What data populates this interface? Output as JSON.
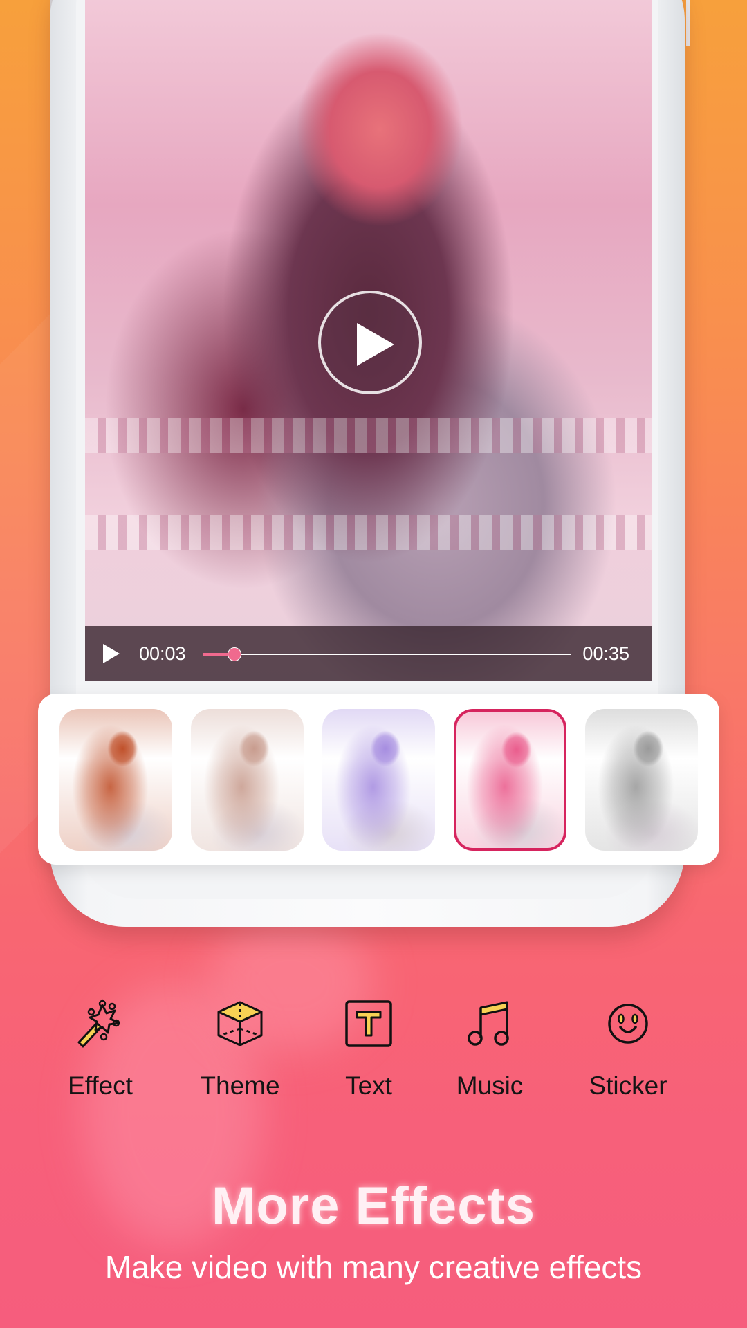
{
  "player": {
    "current_time": "00:03",
    "total_time": "00:35",
    "progress_fraction": 0.0857,
    "big_play_icon": "play-icon",
    "control_play_icon": "play-icon"
  },
  "filters": {
    "selected_index": 3,
    "items": [
      {
        "name": "vivid-warm",
        "tint": "#c0502a"
      },
      {
        "name": "sepia-sketch",
        "tint": "#c89c8e"
      },
      {
        "name": "violet",
        "tint": "#a68de0"
      },
      {
        "name": "pink-sketch",
        "tint": "#ea5d8d"
      },
      {
        "name": "mono-sketch",
        "tint": "#9a9a9a"
      }
    ],
    "selected_border_color": "#d6245e"
  },
  "tools": [
    {
      "label": "Effect",
      "icon": "magic-wand-icon"
    },
    {
      "label": "Theme",
      "icon": "cube-icon"
    },
    {
      "label": "Text",
      "icon": "text-box-icon"
    },
    {
      "label": "Music",
      "icon": "music-note-icon"
    },
    {
      "label": "Sticker",
      "icon": "smiley-icon"
    }
  ],
  "promo": {
    "title": "More Effects",
    "subtitle": "Make video with many creative effects"
  },
  "colors": {
    "accent": "#f06a8e",
    "icon_fill": "#f7d154",
    "bg_top": "#f7a03c",
    "bg_bottom": "#f65d7d"
  }
}
